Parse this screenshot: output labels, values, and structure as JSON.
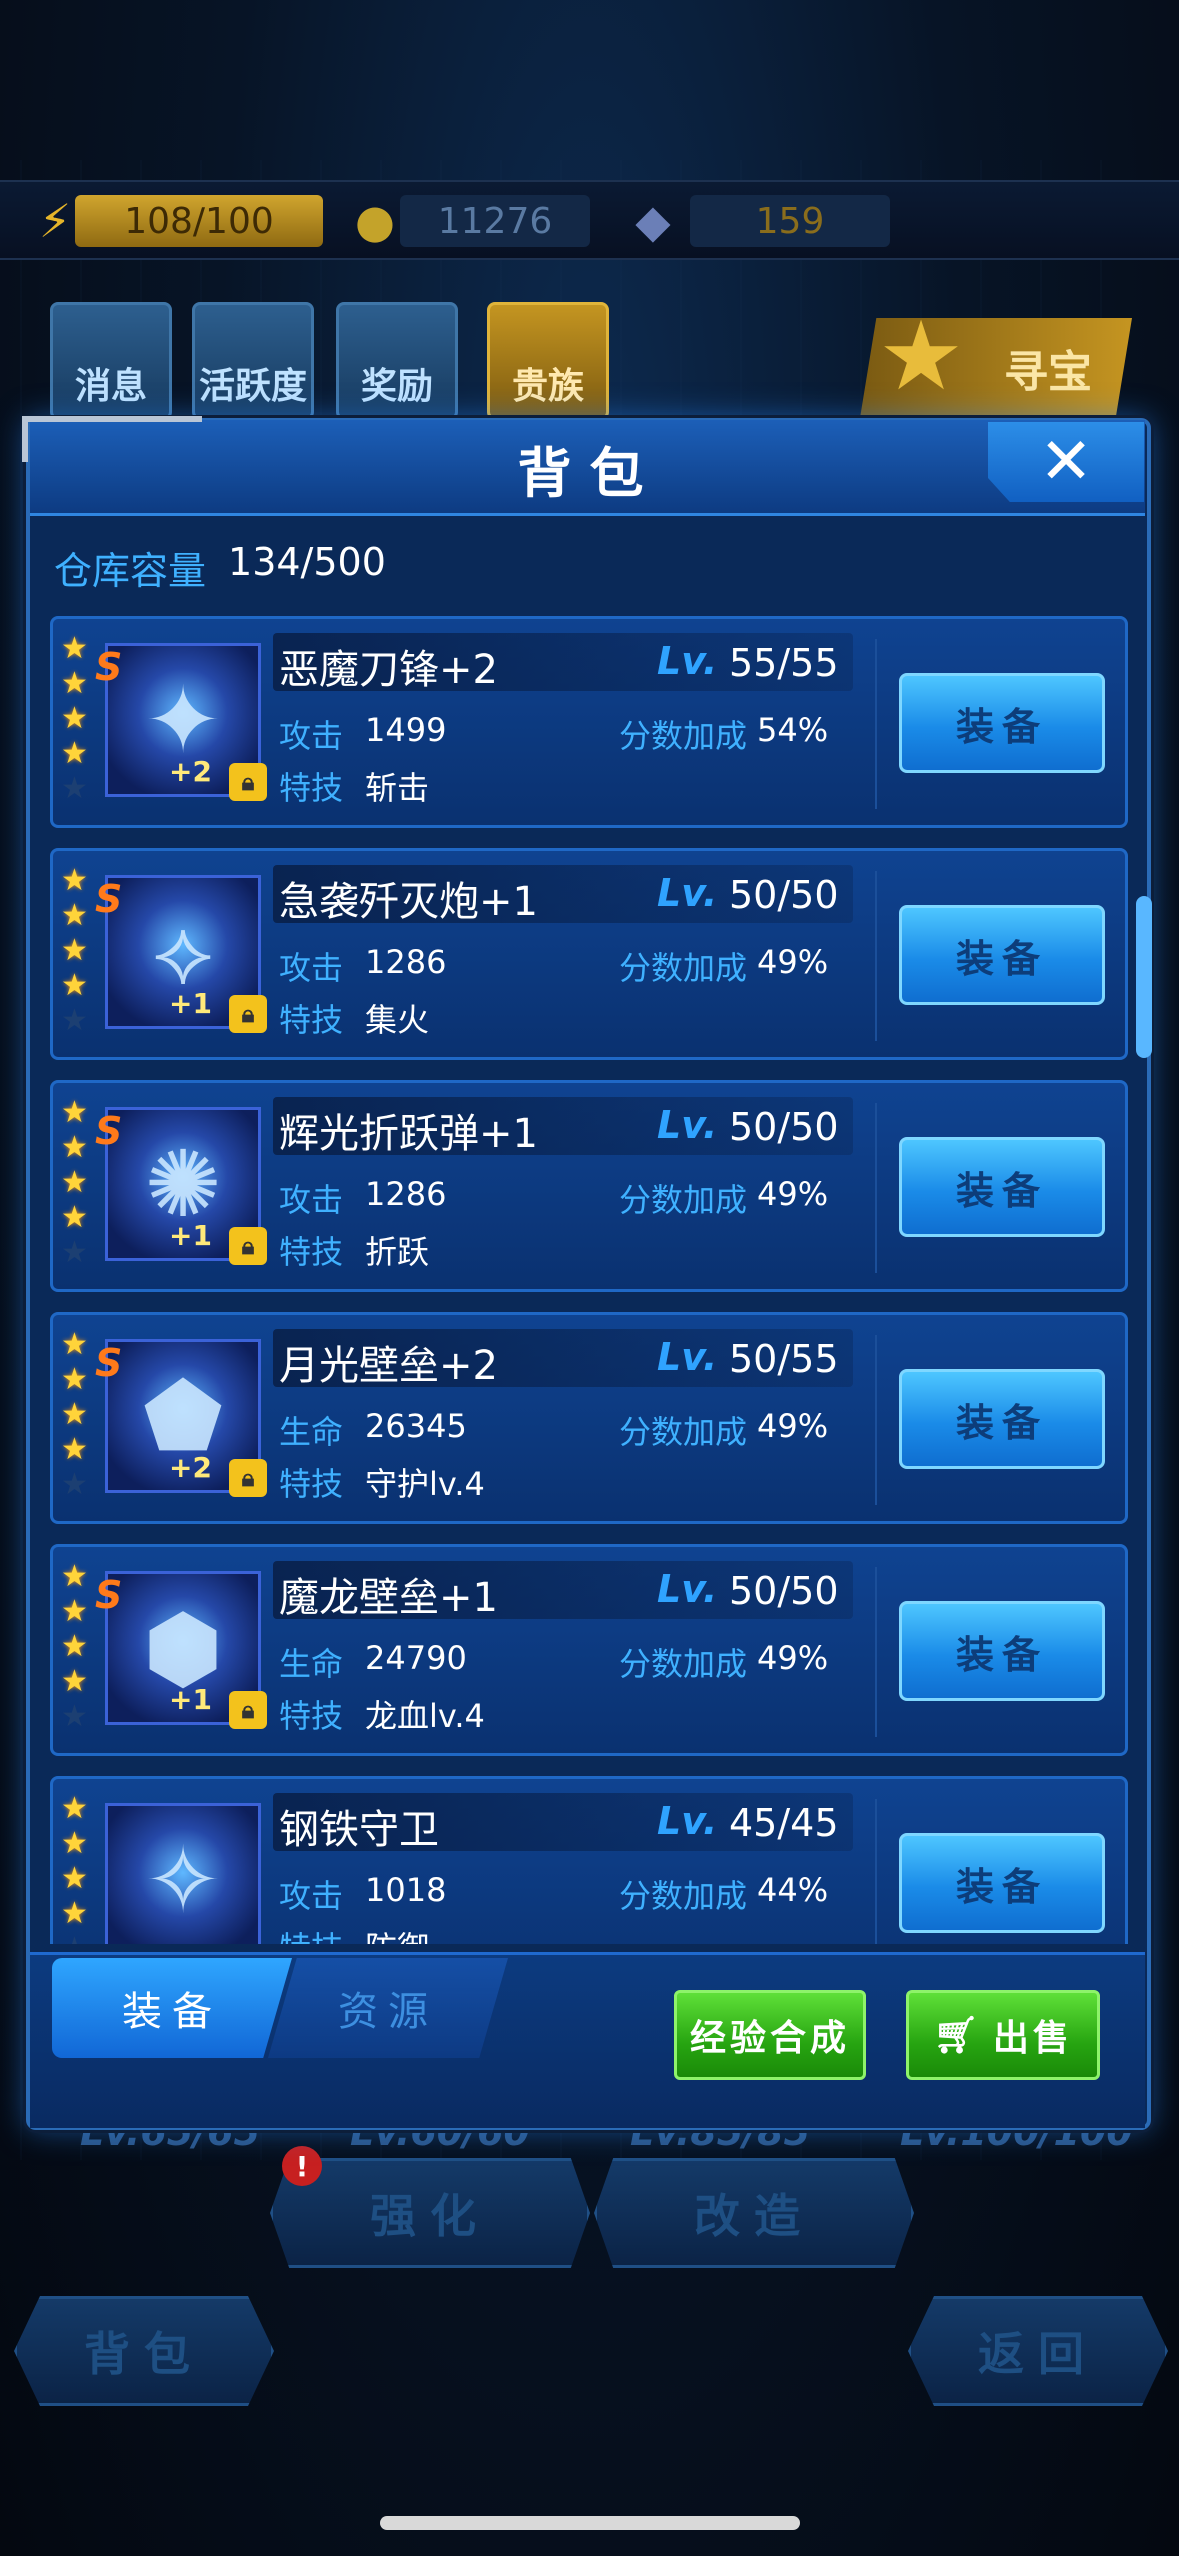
{
  "top": {
    "energy": "108/100",
    "gold": "11276",
    "gems": "159",
    "buttons": [
      "消息",
      "活跃度",
      "奖励",
      "贵族"
    ],
    "treasure": "寻宝"
  },
  "bottom": {
    "levels": [
      "Lv.65/65",
      "Lv.60/60",
      "Lv.85/85",
      "Lv.100/100"
    ],
    "badge": "!",
    "enhance": "强化",
    "modify": "改造",
    "bag": "背包",
    "back": "返回"
  },
  "modal": {
    "title": "背包",
    "close": "✕",
    "capacity_label": "仓库容量",
    "capacity_value": "134/500",
    "equip_label": "装备",
    "lv_label": "Lv.",
    "score_label": "分数加成",
    "skill_label": "特技",
    "items": [
      {
        "name": "恶魔刀锋+2",
        "level": "55/55",
        "stat_label": "攻击",
        "stat": "1499",
        "bonus": "54%",
        "skill": "斩击",
        "plus": "+2",
        "rank": "S",
        "stars": 4
      },
      {
        "name": "急袭歼灭炮+1",
        "level": "50/50",
        "stat_label": "攻击",
        "stat": "1286",
        "bonus": "49%",
        "skill": "集火",
        "plus": "+1",
        "rank": "S",
        "stars": 4
      },
      {
        "name": "辉光折跃弹+1",
        "level": "50/50",
        "stat_label": "攻击",
        "stat": "1286",
        "bonus": "49%",
        "skill": "折跃",
        "plus": "+1",
        "rank": "S",
        "stars": 4
      },
      {
        "name": "月光壁垒+2",
        "level": "50/55",
        "stat_label": "生命",
        "stat": "26345",
        "bonus": "49%",
        "skill": "守护lv.4",
        "plus": "+2",
        "rank": "S",
        "stars": 4
      },
      {
        "name": "魔龙壁垒+1",
        "level": "50/50",
        "stat_label": "生命",
        "stat": "24790",
        "bonus": "49%",
        "skill": "龙血lv.4",
        "plus": "+1",
        "rank": "S",
        "stars": 4
      },
      {
        "name": "钢铁守卫",
        "level": "45/45",
        "stat_label": "攻击",
        "stat": "1018",
        "bonus": "44%",
        "skill": "防御",
        "plus": "",
        "rank": "",
        "stars": 4
      }
    ],
    "tabs": {
      "equipment": "装备",
      "resources": "资源"
    },
    "exp_merge": "经验合成",
    "sell": "出售"
  },
  "colors": {
    "accent": "#2fa3ff",
    "gold": "#ffd43a",
    "green": "#27a511"
  }
}
